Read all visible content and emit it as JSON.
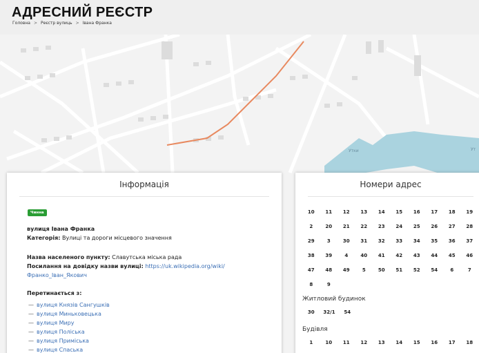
{
  "header": {
    "title": "АДРЕСНИЙ РЕЄСТР",
    "breadcrumb": [
      "Головна",
      "Реєстр вулиць",
      "Івана Франка"
    ],
    "breadcrumb_sep": ">"
  },
  "map": {
    "water_label_1": "Утки",
    "water_label_2": "Ут",
    "water_color": "#aad3df",
    "street_highlight_color": "#e8895f"
  },
  "info": {
    "title": "Інформація",
    "status_badge": "Чинна",
    "street_name": "вулиця Івана Франка",
    "category_label": "Категорія:",
    "category_value": "Вулиці та дороги місцевого значення",
    "settlement_label": "Назва населеного пункту:",
    "settlement_value": "Славутська міська рада",
    "reference_label": "Посилання на довідку назви вулиці:",
    "reference_link_1": "https://uk.wikipedia.org/wiki/",
    "reference_link_2": "Франко_Іван_Якович",
    "crosses_label": "Перетинається з:",
    "crosses": [
      "вулиця Князів Сангушків",
      "вулиця Миньковецька",
      "вулиця Миру",
      "вулиця Поліська",
      "вулиця Приміська",
      "вулиця Спаська"
    ]
  },
  "numbers": {
    "title": "Номери адрес",
    "main": [
      "10",
      "11",
      "12",
      "13",
      "14",
      "15",
      "16",
      "17",
      "18",
      "19",
      "2",
      "20",
      "21",
      "22",
      "23",
      "24",
      "25",
      "26",
      "27",
      "28",
      "29",
      "3",
      "30",
      "31",
      "32",
      "33",
      "34",
      "35",
      "36",
      "37",
      "38",
      "39",
      "4",
      "40",
      "41",
      "42",
      "43",
      "44",
      "45",
      "46",
      "47",
      "48",
      "49",
      "5",
      "50",
      "51",
      "52",
      "54",
      "6",
      "7",
      "8",
      "9"
    ],
    "residential_label": "Житловий будинок",
    "residential": [
      "30",
      "32/1",
      "54"
    ],
    "building_label": "Будівля",
    "building": [
      "1",
      "10",
      "11",
      "12",
      "13",
      "14",
      "15",
      "16",
      "17",
      "18"
    ]
  }
}
